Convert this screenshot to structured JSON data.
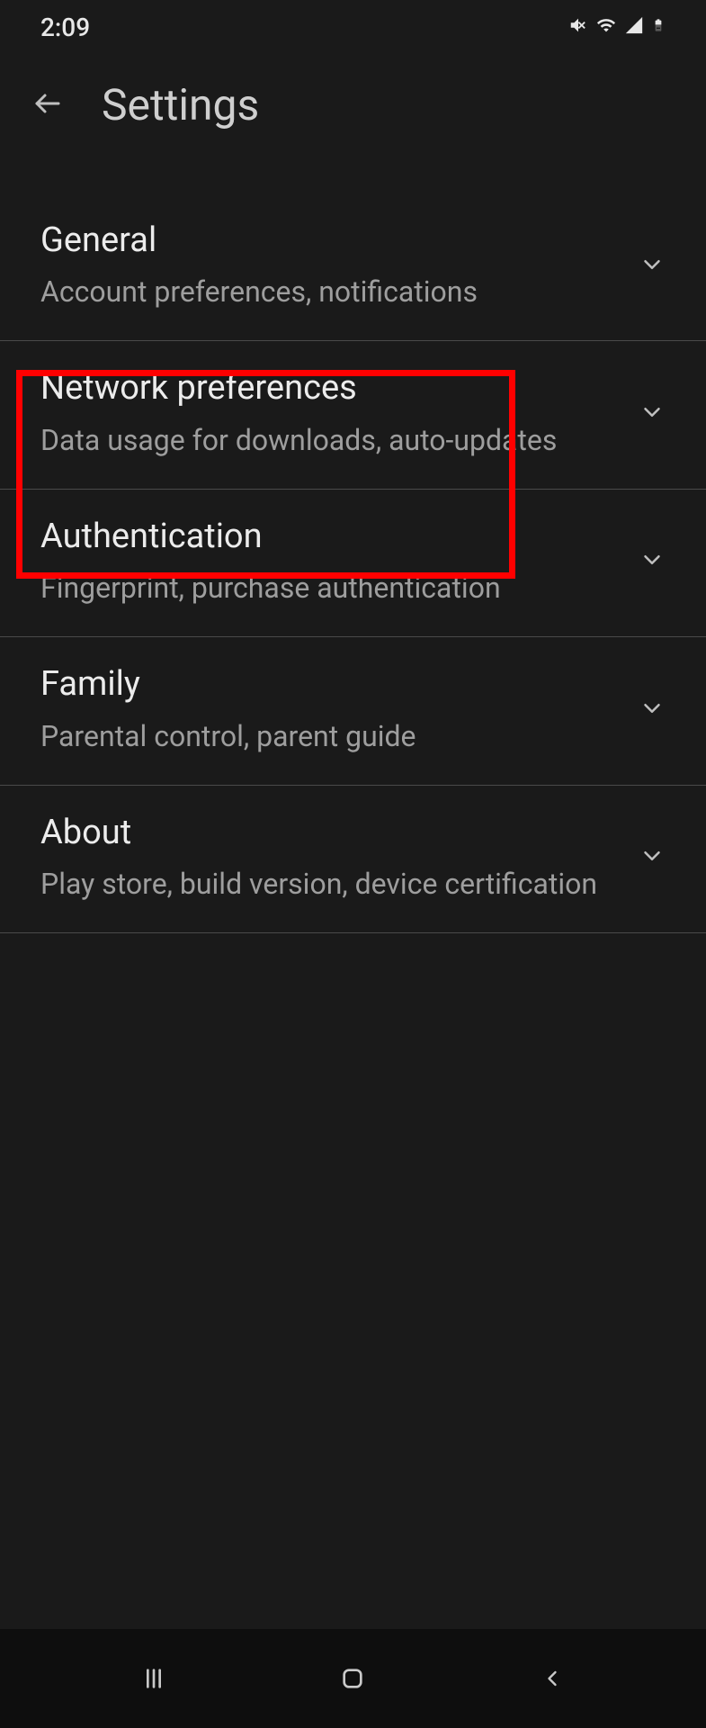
{
  "status_bar": {
    "time": "2:09"
  },
  "app_bar": {
    "title": "Settings"
  },
  "settings": [
    {
      "title": "General",
      "subtitle": "Account preferences, notifications"
    },
    {
      "title": "Network preferences",
      "subtitle": "Data usage for downloads, auto-updates"
    },
    {
      "title": "Authentication",
      "subtitle": "Fingerprint, purchase authentication"
    },
    {
      "title": "Family",
      "subtitle": "Parental control, parent guide"
    },
    {
      "title": "About",
      "subtitle": "Play store, build version, device certification"
    }
  ]
}
